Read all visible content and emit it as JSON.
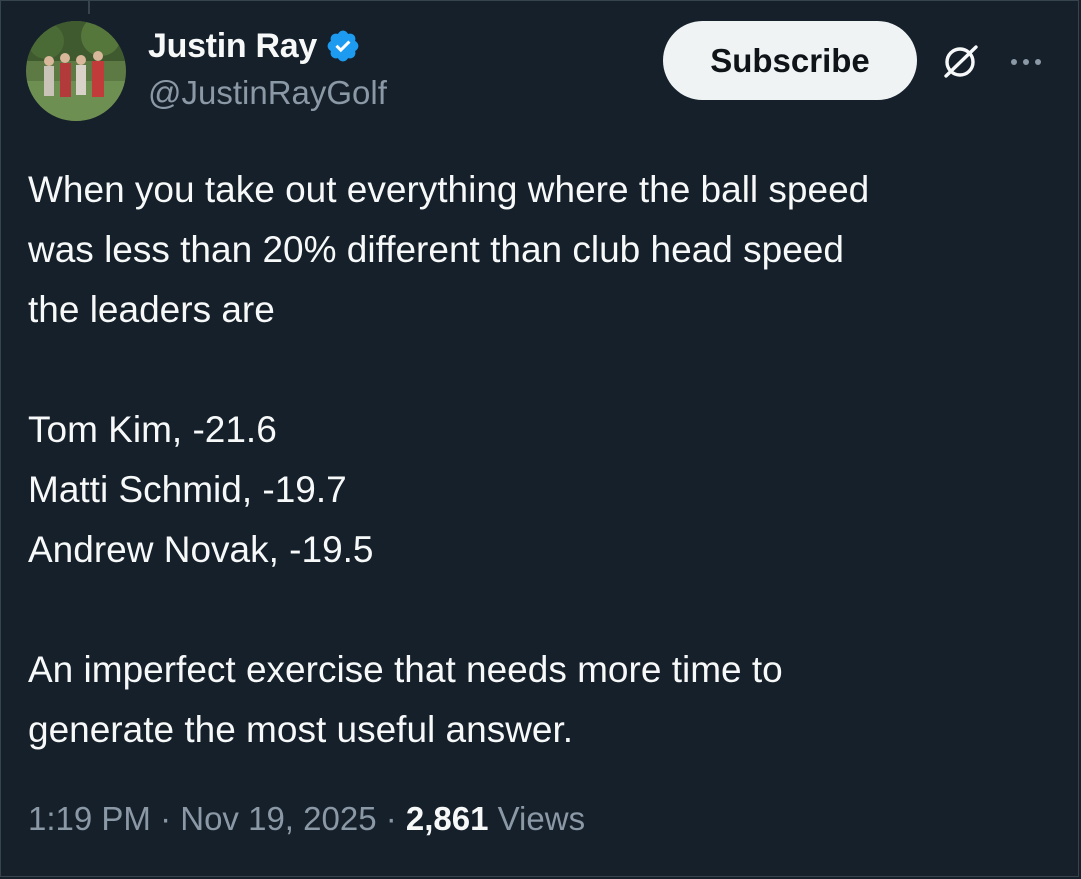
{
  "author": {
    "display_name": "Justin Ray",
    "handle": "@JustinRayGolf",
    "verified": true,
    "verified_color": "#1d9bf0"
  },
  "actions": {
    "subscribe_label": "Subscribe",
    "grok_icon": "grok-icon",
    "more_icon": "more-horizontal-icon"
  },
  "tweet": {
    "paragraph_1_line_1": "When you take out everything where the ball speed",
    "paragraph_1_line_2": "was less than 20% different than club head speed",
    "paragraph_1_line_3": "the leaders are",
    "leaders": [
      "Tom Kim, -21.6",
      "Matti Schmid, -19.7",
      "Andrew Novak, -19.5"
    ],
    "closing_line_1": "An imperfect exercise that needs more time to",
    "closing_line_2": "generate the most useful answer."
  },
  "meta": {
    "time": "1:19 PM",
    "separator": " · ",
    "date": "Nov 19, 2025",
    "views_count": "2,861",
    "views_label": "Views"
  },
  "colors": {
    "background": "#15202b",
    "text_primary": "#f7f9f9",
    "text_secondary": "#8b98a5",
    "button_bg": "#eff3f4",
    "border": "#38444d"
  }
}
